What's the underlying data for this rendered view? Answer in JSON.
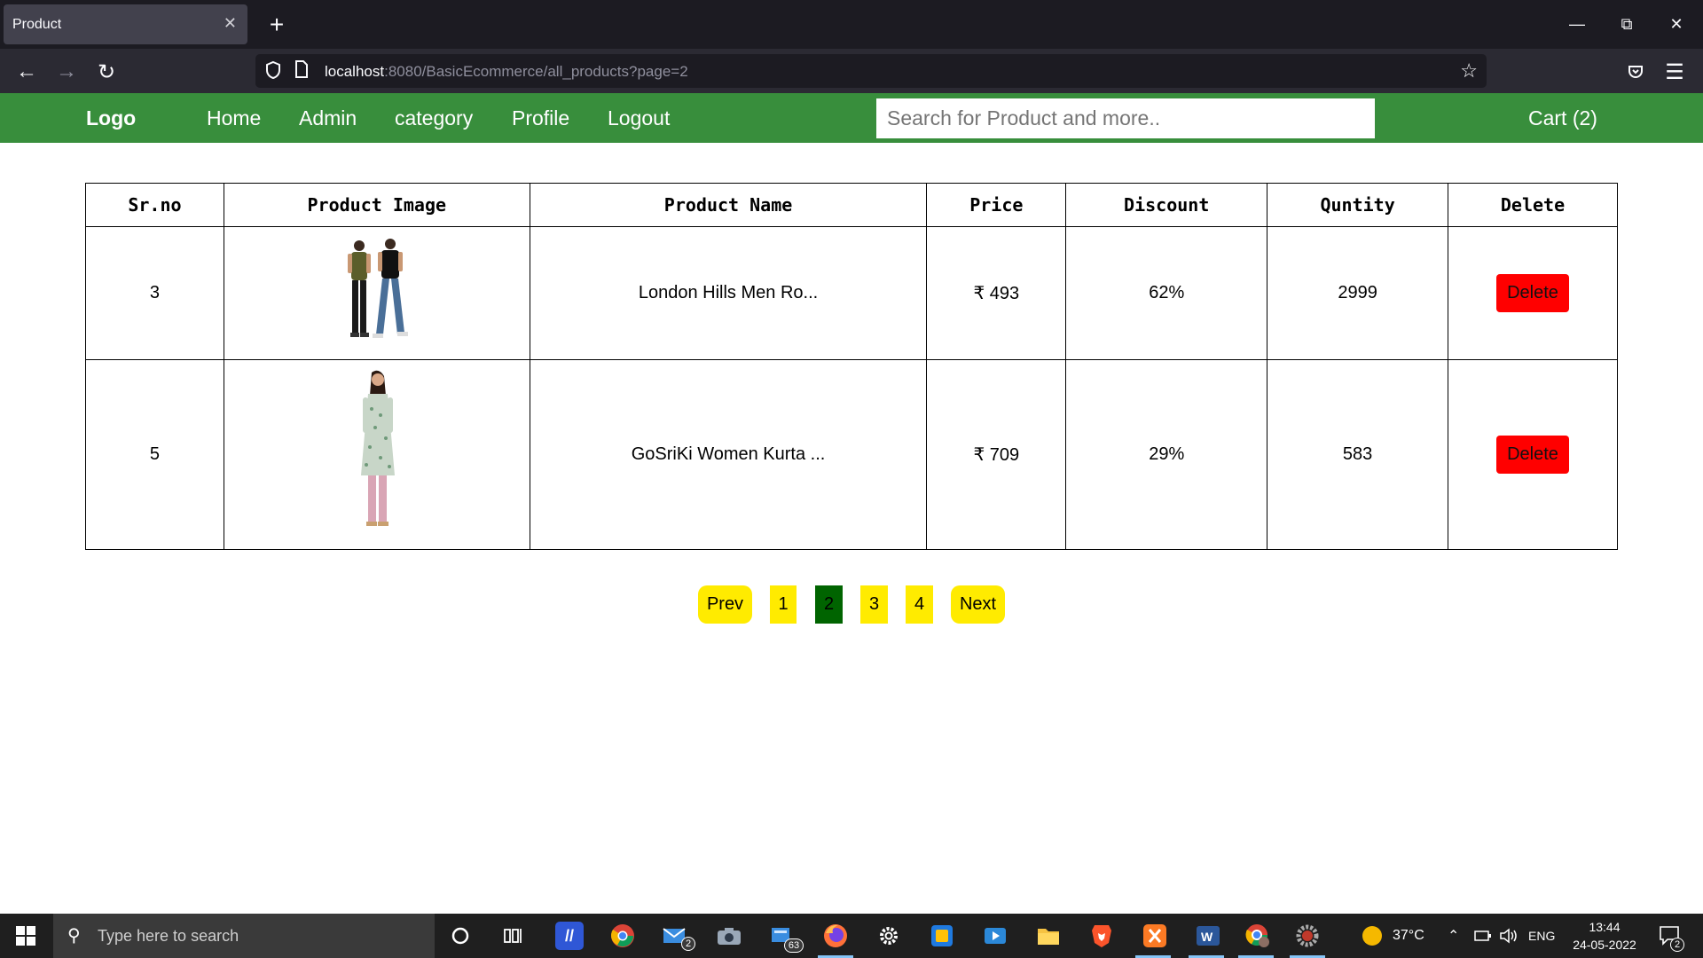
{
  "browser": {
    "tab_title": "Product",
    "tab_close": "✕",
    "new_tab": "+",
    "url_host": "localhost",
    "url_rest": ":8080/BasicEcommerce/all_products?page=2"
  },
  "site": {
    "logo": "Logo",
    "nav": [
      "Home",
      "Admin",
      "category",
      "Profile",
      "Logout"
    ],
    "search_placeholder": "Search for Product and more..",
    "cart": "Cart (2)",
    "header_color": "#388e3c"
  },
  "table": {
    "headers": [
      "Sr.no",
      "Product Image",
      "Product Name",
      "Price",
      "Discount",
      "Quntity",
      "Delete"
    ],
    "rows": [
      {
        "sr": "3",
        "image": "men-tshirt-pair-photo",
        "name": "London Hills Men Ro...",
        "price": "₹ 493",
        "discount": "62%",
        "quantity": "2999",
        "delete": "Delete"
      },
      {
        "sr": "5",
        "image": "women-kurta-photo",
        "name": "GoSriKi Women Kurta ...",
        "price": "₹ 709",
        "discount": "29%",
        "quantity": "583",
        "delete": "Delete"
      }
    ]
  },
  "pagination": {
    "prev": "Prev",
    "pages": [
      "1",
      "2",
      "3",
      "4"
    ],
    "current": "2",
    "next": "Next"
  },
  "taskbar": {
    "search_placeholder": "Type here to search",
    "temperature": "37°C",
    "language": "ENG",
    "time": "13:44",
    "date": "24-05-2022",
    "notification_count": "2",
    "mail_badge": "2",
    "app_badge": "63"
  }
}
